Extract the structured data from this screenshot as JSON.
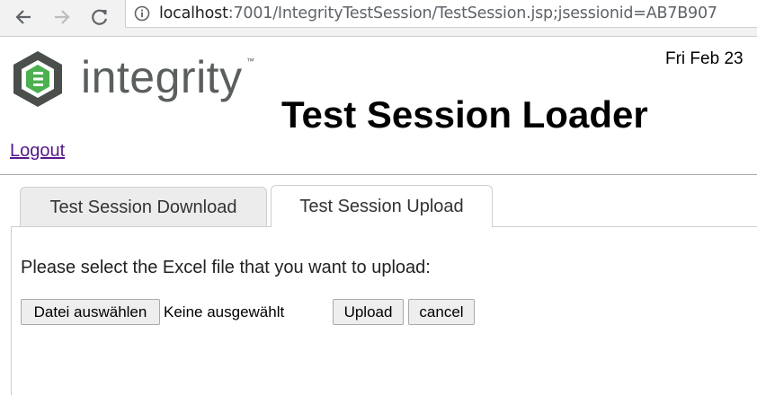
{
  "browser": {
    "url_host": "localhost",
    "url_rest": ":7001/IntegrityTestSession/TestSession.jsp;jsessionid=AB7B907"
  },
  "header": {
    "logo_text": "integrity",
    "logo_tm": "™",
    "date": "Fri Feb 23",
    "title": "Test Session Loader",
    "logout_label": "Logout"
  },
  "tabs": [
    {
      "label": "Test Session Download",
      "active": false
    },
    {
      "label": "Test Session Upload",
      "active": true
    }
  ],
  "upload": {
    "instruction": "Please select the Excel file that you want to upload:",
    "choose_file_label": "Datei auswählen",
    "no_file_text": "Keine ausgewählt",
    "upload_label": "Upload",
    "cancel_label": "cancel"
  },
  "colors": {
    "logo_green": "#4caf50",
    "logo_dark": "#4a4f4c",
    "link_visited": "#551a8b"
  },
  "icons": [
    "back-arrow-icon",
    "forward-arrow-icon",
    "reload-icon",
    "info-icon",
    "integrity-logo-icon"
  ]
}
